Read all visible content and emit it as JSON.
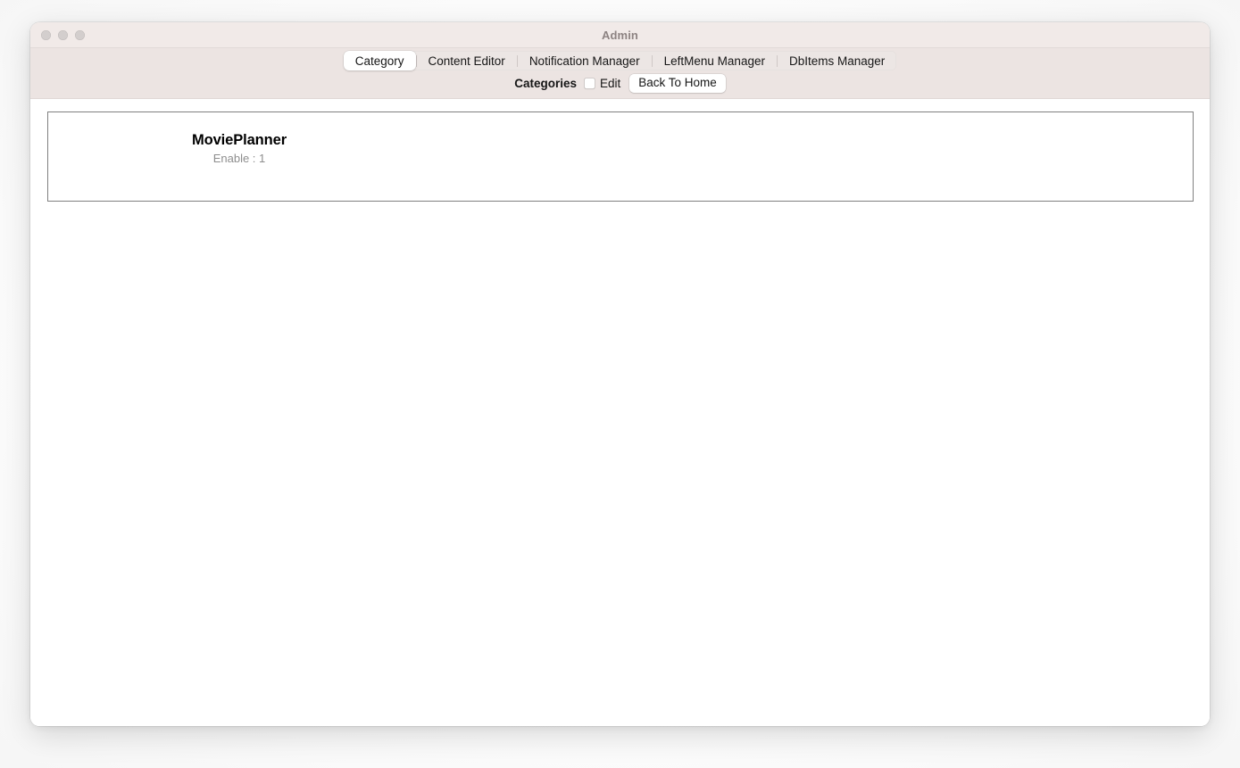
{
  "window": {
    "title": "Admin",
    "traffic_lights": [
      "close",
      "minimize",
      "zoom"
    ]
  },
  "tabs": [
    {
      "label": "Category",
      "selected": true
    },
    {
      "label": "Content Editor",
      "selected": false
    },
    {
      "label": "Notification Manager",
      "selected": false
    },
    {
      "label": "LeftMenu Manager",
      "selected": false
    },
    {
      "label": "DbItems Manager",
      "selected": false
    }
  ],
  "toolbar": {
    "section_label": "Categories",
    "edit_checkbox": {
      "label": "Edit",
      "checked": false
    },
    "back_button_label": "Back To Home"
  },
  "categories": [
    {
      "name": "MoviePlanner",
      "enable_text": "Enable : 1"
    }
  ],
  "colors": {
    "titlebar_bg": "#f1eae8",
    "toolbar_bg": "#ece4e2",
    "content_bg": "#ffffff",
    "title_text": "#8d8382",
    "card_border": "#808080",
    "subtitle_text": "#8e8e8e",
    "selected_tab_bg": "#ffffff"
  }
}
